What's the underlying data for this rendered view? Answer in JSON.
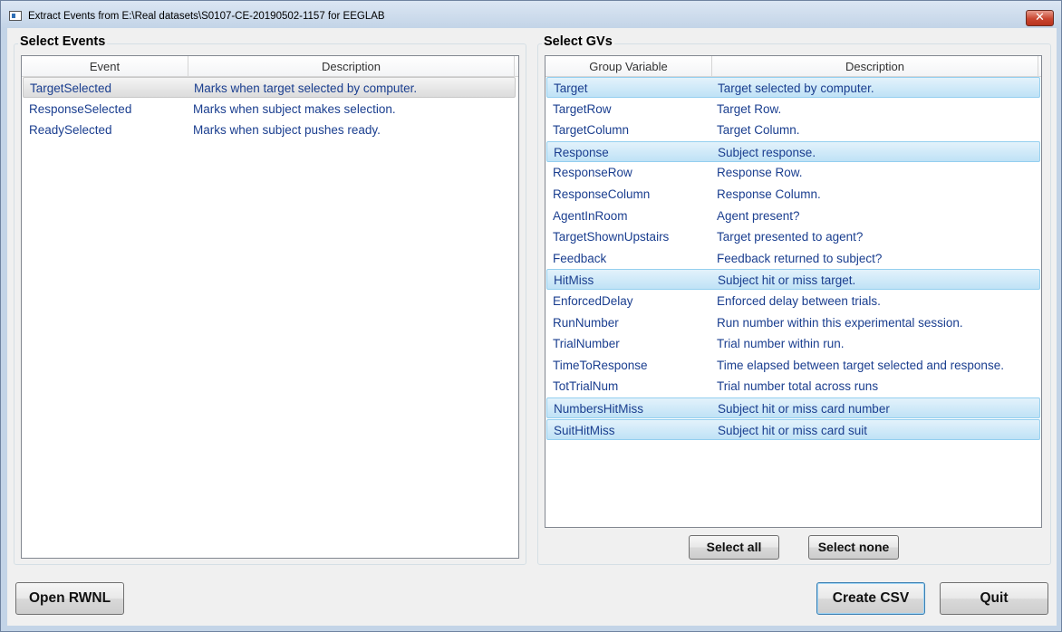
{
  "window": {
    "title": "Extract Events from E:\\Real datasets\\S0107-CE-20190502-1157 for EEGLAB",
    "close_glyph": "✕"
  },
  "events_panel": {
    "title": "Select Events",
    "columns": [
      "Event",
      "Description"
    ],
    "rows": [
      {
        "event": "TargetSelected",
        "description": "Marks when target selected by computer.",
        "selected": true
      },
      {
        "event": "ResponseSelected",
        "description": "Marks when subject makes selection.",
        "selected": false
      },
      {
        "event": "ReadySelected",
        "description": "Marks when subject pushes ready.",
        "selected": false
      }
    ]
  },
  "gvs_panel": {
    "title": "Select GVs",
    "columns": [
      "Group Variable",
      "Description"
    ],
    "rows": [
      {
        "name": "Target",
        "description": "Target selected by computer.",
        "selected": true
      },
      {
        "name": "TargetRow",
        "description": "Target Row.",
        "selected": false
      },
      {
        "name": "TargetColumn",
        "description": "Target Column.",
        "selected": false
      },
      {
        "name": "Response",
        "description": "Subject response.",
        "selected": true
      },
      {
        "name": "ResponseRow",
        "description": "Response Row.",
        "selected": false
      },
      {
        "name": "ResponseColumn",
        "description": "Response Column.",
        "selected": false
      },
      {
        "name": "AgentInRoom",
        "description": "Agent present?",
        "selected": false
      },
      {
        "name": "TargetShownUpstairs",
        "description": "Target presented to agent?",
        "selected": false
      },
      {
        "name": "Feedback",
        "description": "Feedback returned to subject?",
        "selected": false
      },
      {
        "name": "HitMiss",
        "description": "Subject hit or miss target.",
        "selected": true
      },
      {
        "name": "EnforcedDelay",
        "description": "Enforced delay between trials.",
        "selected": false
      },
      {
        "name": "RunNumber",
        "description": "Run number within this experimental session.",
        "selected": false
      },
      {
        "name": "TrialNumber",
        "description": "Trial number within run.",
        "selected": false
      },
      {
        "name": "TimeToResponse",
        "description": "Time elapsed between target selected and response.",
        "selected": false
      },
      {
        "name": "TotTrialNum",
        "description": "Trial number total across runs",
        "selected": false
      },
      {
        "name": "NumbersHitMiss",
        "description": "Subject hit or miss card number",
        "selected": true
      },
      {
        "name": "SuitHitMiss",
        "description": "Subject hit or miss card suit",
        "selected": true
      }
    ],
    "select_all_label": "Select all",
    "select_none_label": "Select none"
  },
  "footer": {
    "open_label": "Open RWNL",
    "create_label": "Create CSV",
    "quit_label": "Quit"
  },
  "colors": {
    "row_text": "#1a3e8f",
    "selection_blue": "#bfe2f6",
    "selection_gray": "#dcdcdc"
  }
}
